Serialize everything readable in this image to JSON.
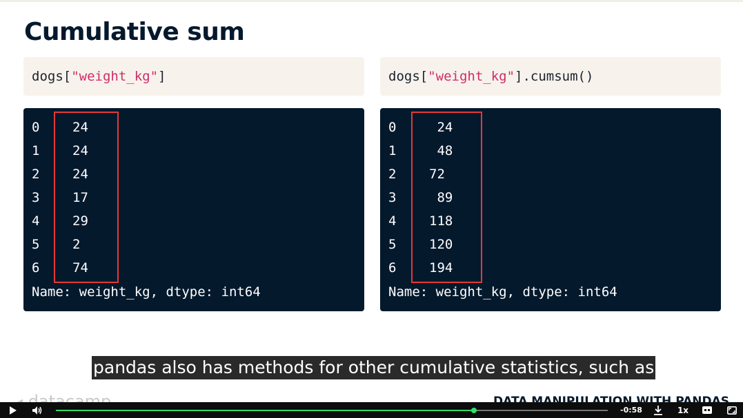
{
  "slide": {
    "title": "Cumulative sum",
    "left_code": {
      "prefix": "dogs[",
      "string": "\"weight_kg\"",
      "suffix": "]"
    },
    "right_code": {
      "prefix": "dogs[",
      "string": "\"weight_kg\"",
      "suffix": "].cumsum()"
    },
    "left_output": {
      "rows": [
        {
          "index": "0",
          "value": "24"
        },
        {
          "index": "1",
          "value": "24"
        },
        {
          "index": "2",
          "value": "24"
        },
        {
          "index": "3",
          "value": "17"
        },
        {
          "index": "4",
          "value": "29"
        },
        {
          "index": "5",
          "value": "2"
        },
        {
          "index": "6",
          "value": "74"
        }
      ],
      "name_line": "Name: weight_kg, dtype: int64"
    },
    "right_output": {
      "rows": [
        {
          "index": "0",
          "value": " 24"
        },
        {
          "index": "1",
          "value": " 48"
        },
        {
          "index": "2",
          "value": "72"
        },
        {
          "index": "3",
          "value": " 89"
        },
        {
          "index": "4",
          "value": "118"
        },
        {
          "index": "5",
          "value": "120"
        },
        {
          "index": "6",
          "value": "194"
        }
      ],
      "name_line": "Name: weight_kg, dtype: int64"
    },
    "highlight_color": "#e53935"
  },
  "subtitle": "pandas also has methods for other cumulative statistics, such as",
  "footer": {
    "logo_text": "datacamp",
    "course_title": "DATA MANIPULATION WITH PANDAS"
  },
  "player": {
    "progress": 0.758,
    "time_remaining": "-0:58",
    "speed": "1x",
    "accent_color": "#2fe06c",
    "icons": [
      "play-icon",
      "volume-icon",
      "download-icon",
      "captions-icon",
      "fullscreen-icon"
    ]
  }
}
